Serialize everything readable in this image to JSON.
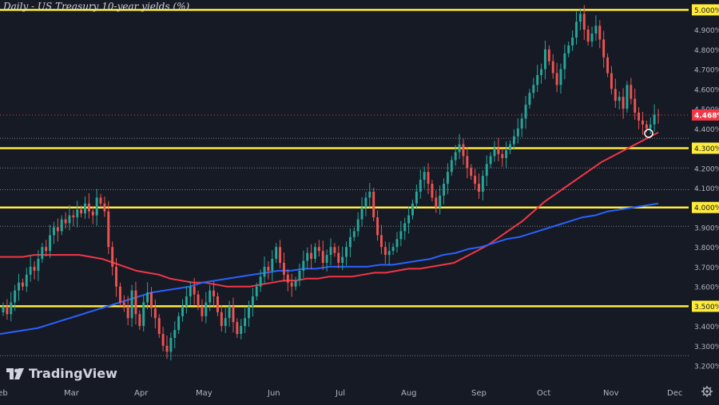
{
  "chart_data": {
    "type": "candlestick",
    "title": "Daily - US Treasury 10-year yields (%)",
    "brand": "TradingView",
    "colors": {
      "background": "#161a25",
      "up": "#26a69a",
      "down": "#ef5350",
      "ma_red": "#f23645",
      "ma_blue": "#2962ff",
      "support_line": "#ffeb3b",
      "axis_text": "#b2b5be",
      "price_tag": "#f23645"
    },
    "ylim": [
      3.15,
      5.05
    ],
    "y_ticks": [
      "3.200%",
      "3.300%",
      "3.400%",
      "3.500%",
      "3.600%",
      "3.700%",
      "3.800%",
      "3.900%",
      "4.000%",
      "4.100%",
      "4.200%",
      "4.300%",
      "4.400%",
      "4.500%",
      "4.600%",
      "4.700%",
      "4.800%",
      "4.900%",
      "5.000%"
    ],
    "x_ticks": [
      "Feb",
      "Mar",
      "Apr",
      "May",
      "Jun",
      "Jul",
      "Aug",
      "Sep",
      "Oct",
      "Nov",
      "Dec"
    ],
    "highlighted_levels": [
      {
        "value": 5.0,
        "label": "5.000%"
      },
      {
        "value": 4.3,
        "label": "4.300%"
      },
      {
        "value": 4.0,
        "label": "4.000%"
      },
      {
        "value": 3.5,
        "label": "3.500%"
      }
    ],
    "dotted_levels": [
      4.35,
      4.2,
      4.09,
      3.905,
      3.25
    ],
    "current_price": {
      "value": 4.468,
      "label": "4.468%"
    },
    "closes": [
      3.5,
      3.46,
      3.52,
      3.58,
      3.62,
      3.6,
      3.66,
      3.7,
      3.68,
      3.74,
      3.8,
      3.78,
      3.86,
      3.9,
      3.88,
      3.94,
      3.92,
      3.96,
      3.95,
      3.99,
      3.97,
      4.02,
      3.98,
      3.96,
      4.05,
      4.02,
      3.98,
      3.8,
      3.7,
      3.6,
      3.52,
      3.5,
      3.44,
      3.58,
      3.46,
      3.4,
      3.52,
      3.57,
      3.49,
      3.44,
      3.36,
      3.3,
      3.27,
      3.34,
      3.38,
      3.45,
      3.5,
      3.55,
      3.6,
      3.56,
      3.5,
      3.45,
      3.52,
      3.58,
      3.55,
      3.47,
      3.4,
      3.44,
      3.5,
      3.42,
      3.36,
      3.4,
      3.44,
      3.5,
      3.55,
      3.6,
      3.65,
      3.7,
      3.68,
      3.74,
      3.8,
      3.72,
      3.66,
      3.62,
      3.6,
      3.63,
      3.68,
      3.73,
      3.77,
      3.74,
      3.8,
      3.78,
      3.72,
      3.76,
      3.8,
      3.77,
      3.72,
      3.75,
      3.8,
      3.85,
      3.88,
      3.94,
      4.0,
      4.05,
      4.08,
      3.95,
      3.86,
      3.8,
      3.76,
      3.78,
      3.8,
      3.84,
      3.88,
      3.92,
      3.96,
      4.02,
      4.08,
      4.14,
      4.18,
      4.12,
      4.05,
      4.0,
      4.06,
      4.12,
      4.18,
      4.24,
      4.28,
      4.32,
      4.26,
      4.2,
      4.16,
      4.12,
      4.08,
      4.16,
      4.22,
      4.26,
      4.3,
      4.27,
      4.25,
      4.29,
      4.32,
      4.36,
      4.4,
      4.45,
      4.52,
      4.58,
      4.62,
      4.67,
      4.7,
      4.8,
      4.74,
      4.68,
      4.62,
      4.7,
      4.78,
      4.82,
      4.86,
      4.94,
      4.98,
      4.9,
      4.84,
      4.88,
      4.92,
      4.85,
      4.76,
      4.68,
      4.6,
      4.54,
      4.56,
      4.5,
      4.62,
      4.55,
      4.48,
      4.44,
      4.42,
      4.4,
      4.42,
      4.47,
      4.468
    ],
    "ma_red": [
      3.75,
      3.75,
      3.75,
      3.76,
      3.76,
      3.76,
      3.76,
      3.76,
      3.75,
      3.74,
      3.72,
      3.7,
      3.68,
      3.67,
      3.66,
      3.64,
      3.63,
      3.62,
      3.62,
      3.61,
      3.6,
      3.6,
      3.6,
      3.61,
      3.62,
      3.63,
      3.63,
      3.64,
      3.64,
      3.65,
      3.65,
      3.65,
      3.66,
      3.67,
      3.67,
      3.68,
      3.69,
      3.69,
      3.7,
      3.71,
      3.72,
      3.75,
      3.78,
      3.81,
      3.85,
      3.89,
      3.93,
      3.98,
      4.03,
      4.07,
      4.11,
      4.15,
      4.19,
      4.23,
      4.26,
      4.29,
      4.32,
      4.35,
      4.38
    ],
    "ma_blue": [
      3.36,
      3.37,
      3.38,
      3.39,
      3.41,
      3.43,
      3.45,
      3.47,
      3.49,
      3.51,
      3.53,
      3.55,
      3.57,
      3.58,
      3.59,
      3.6,
      3.62,
      3.63,
      3.64,
      3.65,
      3.66,
      3.67,
      3.68,
      3.68,
      3.69,
      3.69,
      3.7,
      3.7,
      3.7,
      3.7,
      3.71,
      3.71,
      3.72,
      3.73,
      3.74,
      3.76,
      3.77,
      3.79,
      3.8,
      3.82,
      3.84,
      3.85,
      3.87,
      3.89,
      3.91,
      3.93,
      3.95,
      3.96,
      3.98,
      3.99,
      4.0,
      4.01,
      4.02
    ]
  }
}
